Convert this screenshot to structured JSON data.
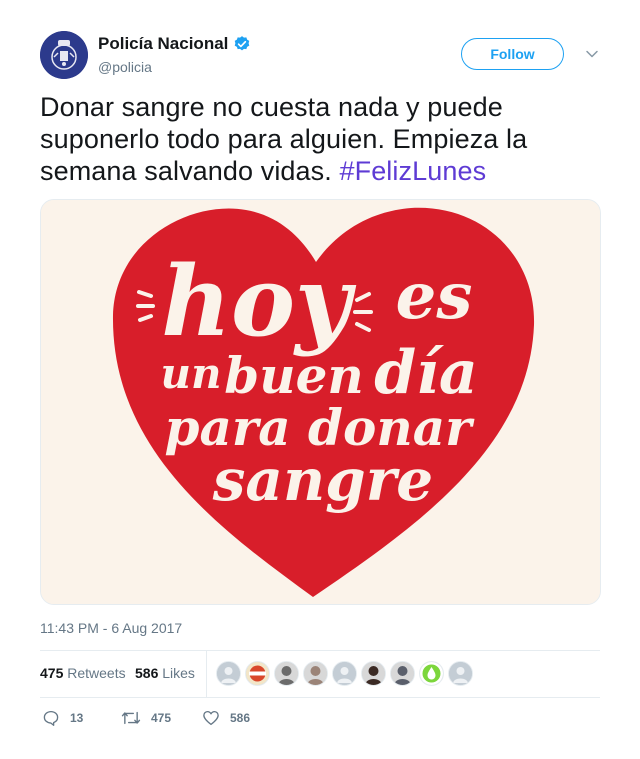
{
  "user": {
    "display_name": "Policía Nacional",
    "handle": "@policia",
    "verified": true,
    "avatar_color": "#2c3a8c"
  },
  "follow_button": {
    "label": "Follow",
    "color": "#1da1f2"
  },
  "tweet": {
    "text": "Donar sangre no cuesta nada y puede suponerlo todo para alguien. Empieza la semana salvando vidas.",
    "hashtag": "#FelizLunes",
    "hashtag_color": "#5e3bd4"
  },
  "media": {
    "lines": [
      "hoy",
      "es",
      "un",
      "buen",
      "día",
      "para donar",
      "sangre"
    ],
    "heart_color": "#d81e2a",
    "text_color": "#fbf3ea",
    "background": "#fbf3ea"
  },
  "timestamp": "11:43 PM - 6 Aug 2017",
  "stats": {
    "retweets_count": "475",
    "retweets_label": "Retweets",
    "likes_count": "586",
    "likes_label": "Likes"
  },
  "liked_by_avatars": [
    {
      "kind": "default-avatar-icon"
    },
    {
      "kind": "badge-avatar-icon",
      "color": "#d9472b"
    },
    {
      "kind": "photo-avatar-icon",
      "color": "#6b6b6b"
    },
    {
      "kind": "photo-avatar-icon",
      "color": "#9b8478"
    },
    {
      "kind": "default-avatar-icon"
    },
    {
      "kind": "photo-avatar-icon",
      "color": "#3b2a24"
    },
    {
      "kind": "photo-avatar-icon",
      "color": "#5a5f6b"
    },
    {
      "kind": "drop-avatar-icon",
      "color": "#7cd63c"
    },
    {
      "kind": "default-avatar-icon"
    }
  ],
  "actions": {
    "reply_count": "13",
    "retweet_count": "475",
    "like_count": "586"
  }
}
